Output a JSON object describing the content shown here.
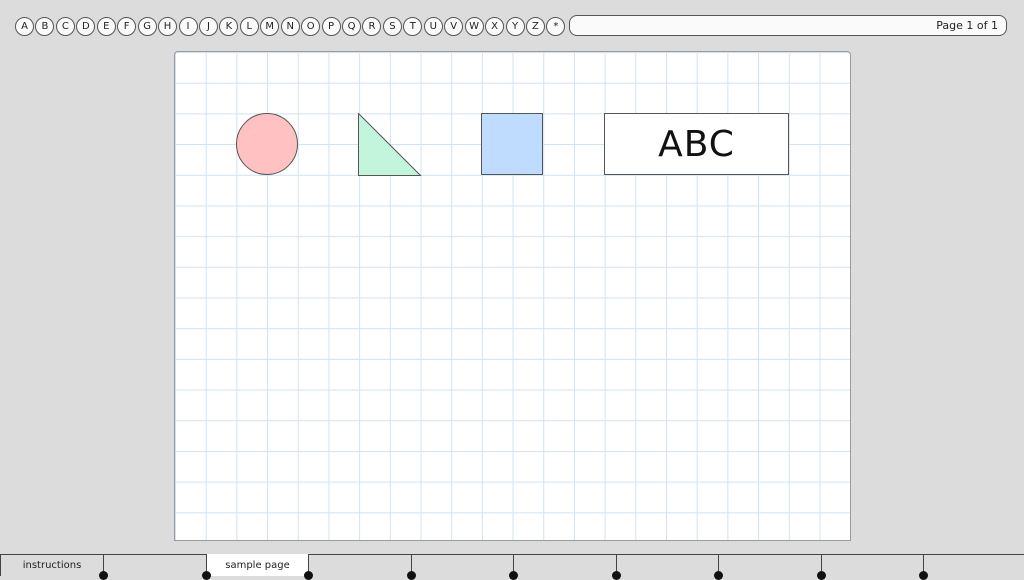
{
  "toolbar": {
    "letters": [
      "A",
      "B",
      "C",
      "D",
      "E",
      "F",
      "G",
      "H",
      "I",
      "J",
      "K",
      "L",
      "M",
      "N",
      "O",
      "P",
      "Q",
      "R",
      "S",
      "T",
      "U",
      "V",
      "W",
      "X",
      "Y",
      "Z",
      "*"
    ],
    "page_indicator": "Page 1 of 1"
  },
  "canvas": {
    "shapes": [
      {
        "type": "circle",
        "fill": "#ffc1c1"
      },
      {
        "type": "right-triangle",
        "fill": "#c2f5dc"
      },
      {
        "type": "square",
        "fill": "#bfdcff"
      },
      {
        "type": "text-box",
        "text": "ABC"
      }
    ]
  },
  "tabs": [
    {
      "label": "instructions",
      "active": false
    },
    {
      "label": "",
      "active": false
    },
    {
      "label": "sample page",
      "active": true
    },
    {
      "label": "",
      "active": false
    },
    {
      "label": "",
      "active": false
    },
    {
      "label": "",
      "active": false
    },
    {
      "label": "",
      "active": false
    },
    {
      "label": "",
      "active": false
    },
    {
      "label": "",
      "active": false
    },
    {
      "label": "",
      "active": false
    }
  ]
}
